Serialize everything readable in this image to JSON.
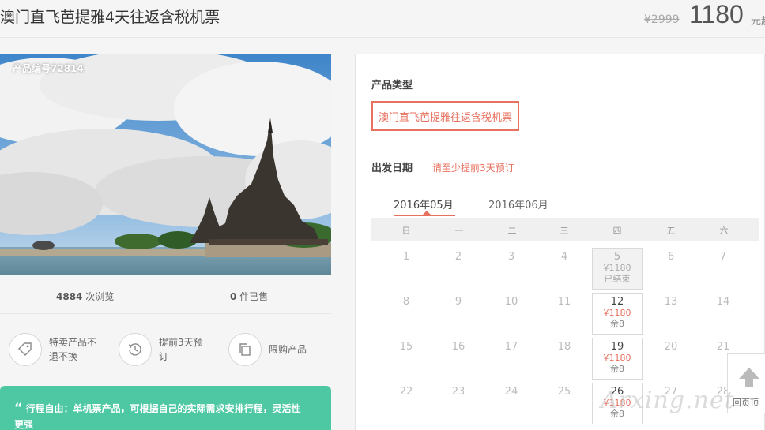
{
  "header": {
    "title": "澳门直飞芭提雅4天往返含税机票",
    "price_original": "¥2999",
    "price_current": "1180",
    "price_unit": "元起"
  },
  "gallery": {
    "product_no": "产品编号72814"
  },
  "stats": {
    "views_count": "4884",
    "views_label": "次浏览",
    "sold_count": "0",
    "sold_label": "件已售"
  },
  "features": [
    {
      "icon": "tag-icon",
      "line1": "特卖产品不",
      "line2": "退不换"
    },
    {
      "icon": "clock-icon",
      "line1": "提前3天预",
      "line2": "订"
    },
    {
      "icon": "copy-icon",
      "line1": "限购产品",
      "line2": ""
    }
  ],
  "notice": {
    "quote": "“",
    "text_line1": "行程自由：单机票产品，可根据自己的实际需求安排行程，灵活性",
    "text_line2": "更强"
  },
  "booking": {
    "type_label": "产品类型",
    "type_option": "澳门直飞芭提雅往返含税机票",
    "date_label": "出发日期",
    "date_hint": "请至少提前3天预订",
    "months": [
      "2016年05月",
      "2016年06月"
    ],
    "weekdays": [
      "日",
      "一",
      "二",
      "三",
      "四",
      "五",
      "六"
    ],
    "plain_days": [
      "1",
      "2",
      "3",
      "4",
      "6",
      "7",
      "8",
      "9",
      "10",
      "11",
      "13",
      "14",
      "15",
      "16",
      "17",
      "18",
      "20",
      "21",
      "22",
      "23",
      "24",
      "25",
      "27",
      "28"
    ],
    "cells": [
      {
        "day": "5",
        "price": "¥1180",
        "status": "已结束"
      },
      {
        "day": "12",
        "price": "¥1180",
        "status": "余8"
      },
      {
        "day": "19",
        "price": "¥1180",
        "status": "余8"
      },
      {
        "day": "26",
        "price": "¥1180",
        "status": "余8"
      }
    ]
  },
  "backtop": {
    "label": "回页顶"
  },
  "watermark": "Arxing.net",
  "colors": {
    "accent": "#e8705e",
    "notice_bg": "#4ec8a3"
  }
}
